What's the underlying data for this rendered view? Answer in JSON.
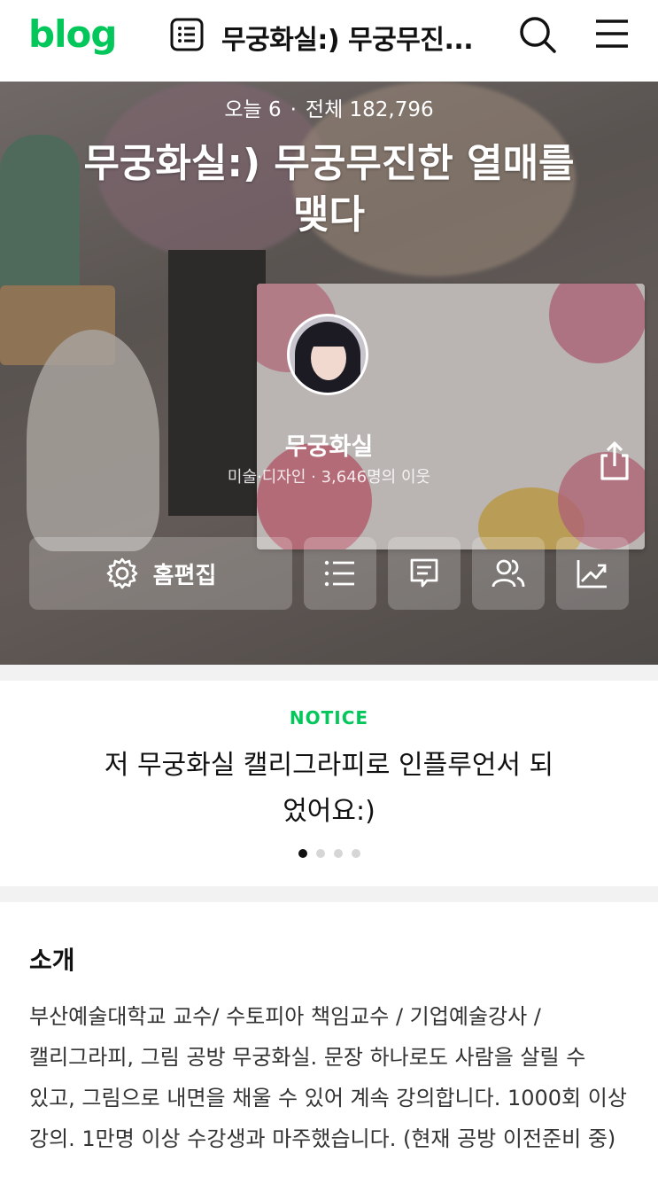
{
  "header": {
    "logo": "blog",
    "title": "무궁화실:) 무궁무진...",
    "icons": [
      "post-list-icon",
      "search-icon",
      "menu-icon"
    ]
  },
  "hero": {
    "today_label": "오늘 6",
    "separator": "·",
    "total_label": "전체 182,796",
    "blog_title_line1": "무궁화실:) 무궁무진한 열매를",
    "blog_title_line2": "맺다",
    "nickname": "무궁화실",
    "category": "미술·디자인 · 3,646명의 이웃",
    "edit_button_label": "홈편집",
    "buttons": [
      "settings-icon",
      "list-icon",
      "comment-icon",
      "neighbors-icon",
      "stats-icon"
    ]
  },
  "notice": {
    "label": "NOTICE",
    "text_line1": "저 무궁화실 캘리그라피로 인플루언서 되",
    "text_line2": "었어요:)",
    "dots_total": 4,
    "dots_active": 1
  },
  "intro": {
    "title": "소개",
    "body": "부산예술대학교 교수/ 수토피아 책임교수 / 기업예술강사 / 캘리그라피, 그림 공방 무궁화실. 문장 하나로도 사람을 살릴 수 있고, 그림으로 내면을 채울 수 있어 계속 강의합니다. 1000회 이상 강의. 1만명 이상 수강생과 마주했습니다. (현재 공방 이전준비 중)"
  },
  "colors": {
    "brand_green": "#03c75a",
    "text_dark": "#111111",
    "divider": "#f2f2f2"
  }
}
